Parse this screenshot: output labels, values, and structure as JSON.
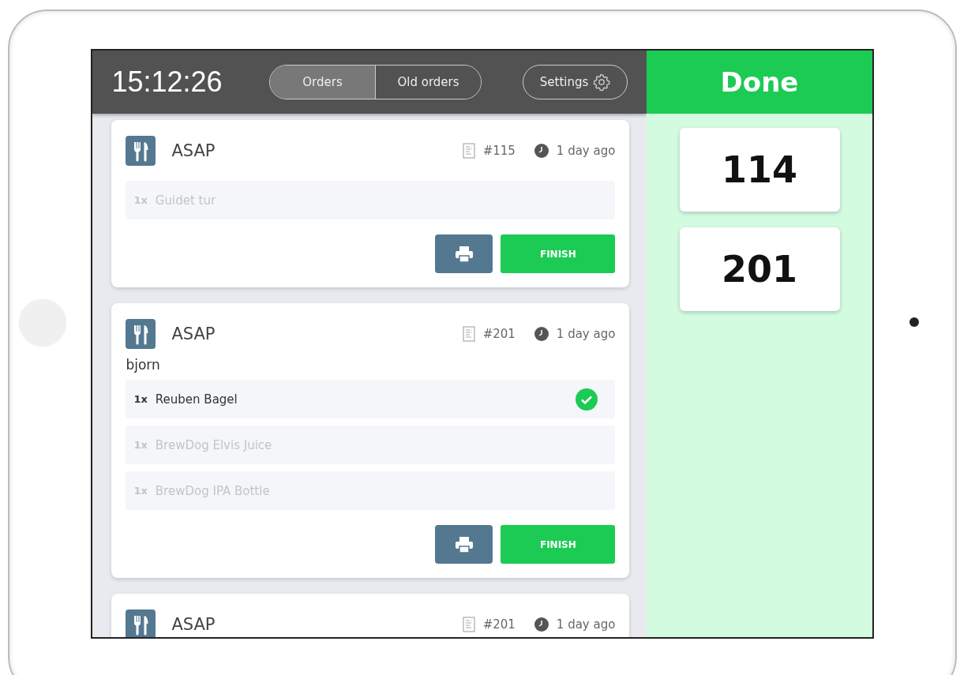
{
  "header": {
    "clock": "15:12:26",
    "tabs": [
      {
        "label": "Orders",
        "selected": true
      },
      {
        "label": "Old orders",
        "selected": false
      }
    ],
    "settings": "Settings"
  },
  "orders": [
    {
      "title": "ASAP",
      "number": "#115",
      "time": "1 day ago",
      "items": [
        {
          "qty": "1x",
          "name": "Guidet tur",
          "done": false
        }
      ],
      "finish": "FINISH"
    },
    {
      "title": "ASAP",
      "number": "#201",
      "time": "1 day ago",
      "customer": "bjorn",
      "items": [
        {
          "qty": "1x",
          "name": "Reuben Bagel",
          "done": true
        },
        {
          "qty": "1x",
          "name": "BrewDog Elvis Juice",
          "done": false
        },
        {
          "qty": "1x",
          "name": "BrewDog IPA Bottle",
          "done": false
        }
      ],
      "finish": "FINISH"
    },
    {
      "title": "ASAP",
      "number": "#201",
      "time": "1 day ago"
    }
  ],
  "done": {
    "title": "Done",
    "numbers": [
      "114",
      "201"
    ]
  }
}
